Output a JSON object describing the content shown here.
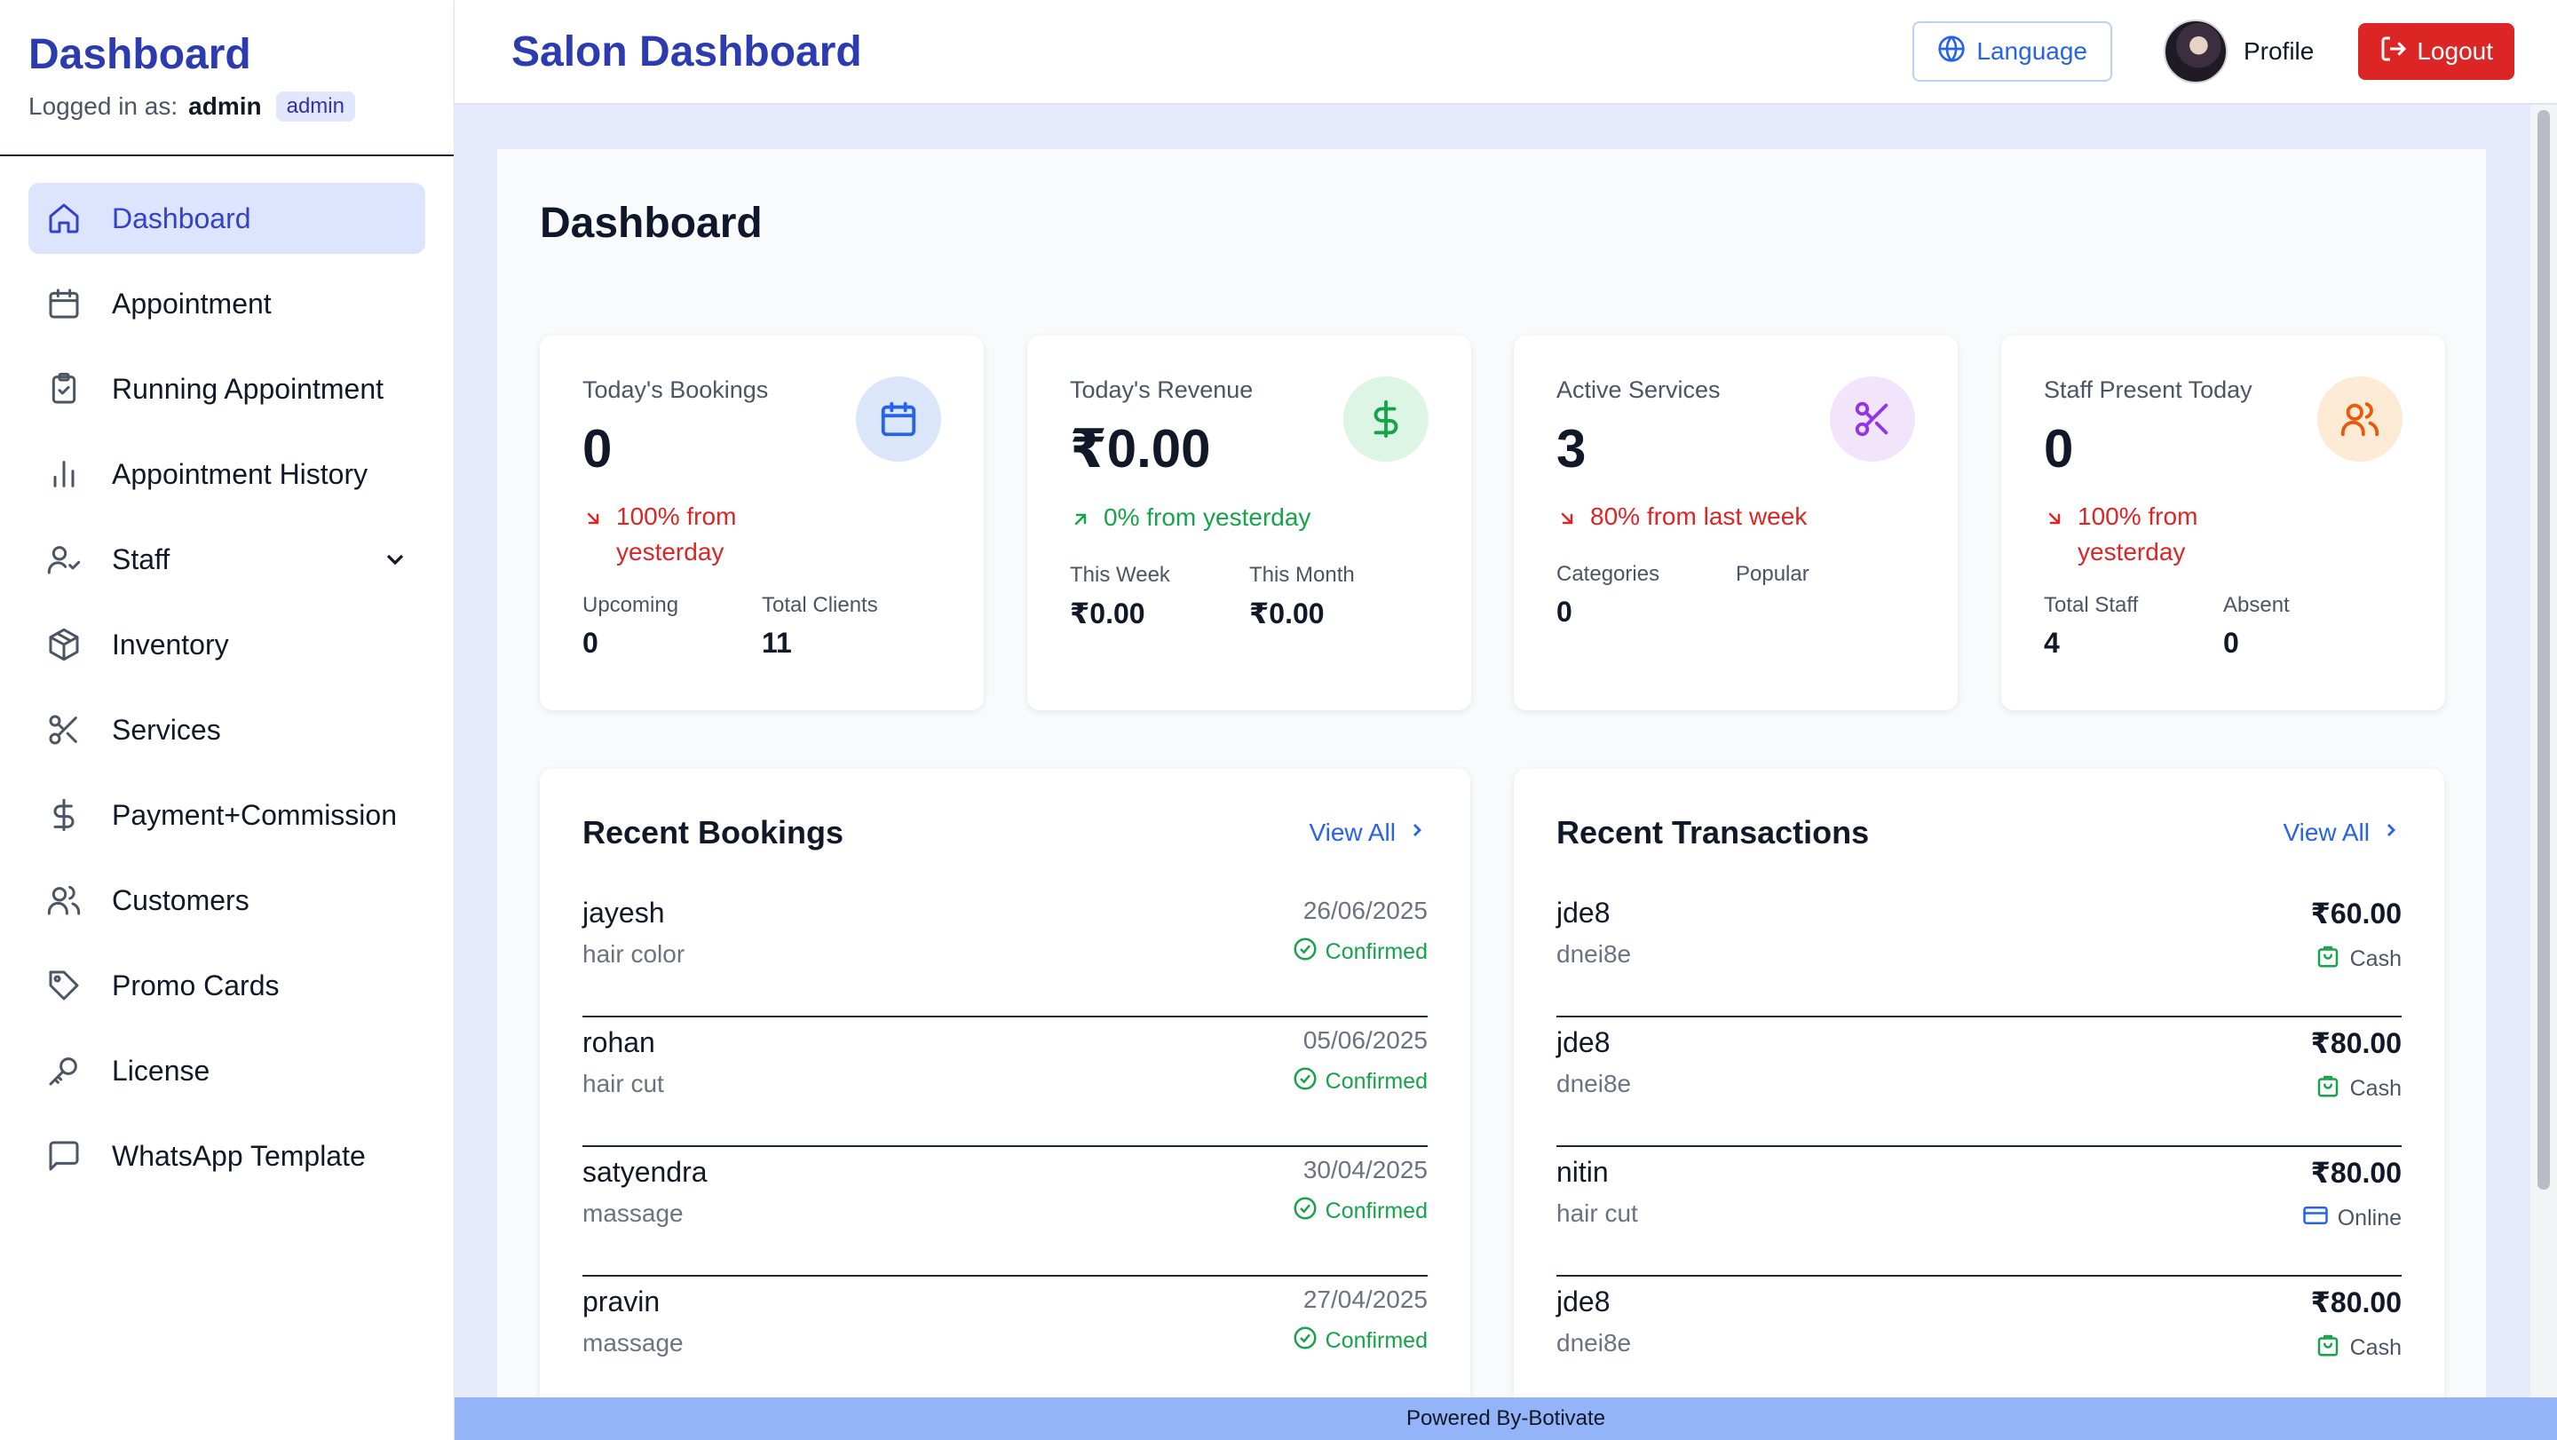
{
  "sidebar": {
    "brand": "Dashboard",
    "logged_in_prefix": "Logged in as:",
    "username": "admin",
    "role": "admin",
    "items": [
      {
        "label": "Dashboard",
        "icon": "home-icon",
        "active": true
      },
      {
        "label": "Appointment",
        "icon": "calendar-icon"
      },
      {
        "label": "Running Appointment",
        "icon": "clipboard-check-icon"
      },
      {
        "label": "Appointment History",
        "icon": "bar-chart-icon"
      },
      {
        "label": "Staff",
        "icon": "user-check-icon",
        "expandable": true
      },
      {
        "label": "Inventory",
        "icon": "package-icon"
      },
      {
        "label": "Services",
        "icon": "scissors-icon"
      },
      {
        "label": "Payment+Commission",
        "icon": "dollar-icon"
      },
      {
        "label": "Customers",
        "icon": "users-icon"
      },
      {
        "label": "Promo Cards",
        "icon": "tag-icon"
      },
      {
        "label": "License",
        "icon": "key-icon"
      },
      {
        "label": "WhatsApp Template",
        "icon": "message-icon"
      }
    ]
  },
  "header": {
    "title": "Salon Dashboard",
    "language_label": "Language",
    "profile_label": "Profile",
    "logout_label": "Logout"
  },
  "main": {
    "page_title": "Dashboard",
    "stats": [
      {
        "label": "Today's Bookings",
        "value": "0",
        "icon": "calendar-icon",
        "trend": "100% from yesterday",
        "trend_dir": "down",
        "sub": [
          {
            "label": "Upcoming",
            "value": "0"
          },
          {
            "label": "Total Clients",
            "value": "11"
          }
        ]
      },
      {
        "label": "Today's Revenue",
        "value": "₹0.00",
        "icon": "dollar-icon",
        "trend": "0% from yesterday",
        "trend_dir": "up",
        "sub": [
          {
            "label": "This Week",
            "value": "₹0.00"
          },
          {
            "label": "This Month",
            "value": "₹0.00"
          }
        ]
      },
      {
        "label": "Active Services",
        "value": "3",
        "icon": "scissors-icon",
        "trend": "80% from last week",
        "trend_dir": "down",
        "sub": [
          {
            "label": "Categories",
            "value": "0"
          },
          {
            "label": "Popular",
            "value": ""
          }
        ]
      },
      {
        "label": "Staff Present Today",
        "value": "0",
        "icon": "users-icon",
        "trend": "100% from yesterday",
        "trend_dir": "down",
        "sub": [
          {
            "label": "Total Staff",
            "value": "4"
          },
          {
            "label": "Absent",
            "value": "0"
          }
        ]
      }
    ],
    "recent_bookings": {
      "title": "Recent Bookings",
      "view_all": "View All",
      "rows": [
        {
          "name": "jayesh",
          "service": "hair color",
          "date": "26/06/2025",
          "status": "Confirmed"
        },
        {
          "name": "rohan",
          "service": "hair cut",
          "date": "05/06/2025",
          "status": "Confirmed"
        },
        {
          "name": "satyendra",
          "service": "massage",
          "date": "30/04/2025",
          "status": "Confirmed"
        },
        {
          "name": "pravin",
          "service": "massage",
          "date": "27/04/2025",
          "status": "Confirmed"
        }
      ]
    },
    "recent_transactions": {
      "title": "Recent Transactions",
      "view_all": "View All",
      "rows": [
        {
          "name": "jde8",
          "detail": "dnei8e",
          "amount": "₹60.00",
          "method": "Cash",
          "method_icon": "cash-bag-icon"
        },
        {
          "name": "jde8",
          "detail": "dnei8e",
          "amount": "₹80.00",
          "method": "Cash",
          "method_icon": "cash-bag-icon"
        },
        {
          "name": "nitin",
          "detail": "hair cut",
          "amount": "₹80.00",
          "method": "Online",
          "method_icon": "credit-card-icon"
        },
        {
          "name": "jde8",
          "detail": "dnei8e",
          "amount": "₹80.00",
          "method": "Cash",
          "method_icon": "cash-bag-icon"
        }
      ]
    }
  },
  "footer": {
    "text": "Powered By-Botivate"
  },
  "colors": {
    "brand": "#2d3bb0",
    "active_nav_bg": "#dde4fd",
    "logout": "#dc2626",
    "trend_down": "#dc2626",
    "trend_up": "#16a34a",
    "footer_bg": "#93b4f8"
  }
}
